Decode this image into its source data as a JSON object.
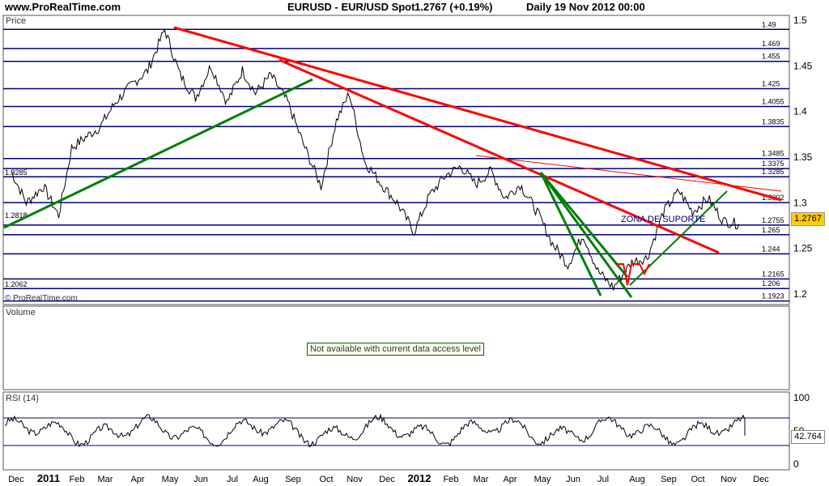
{
  "header": {
    "site": "www.ProRealTime.com",
    "instrument": "EURUSD - EUR/USD Spot",
    "last": "1.2767 (+0.19%)",
    "period": "Daily  19 Nov 2012 00:00"
  },
  "panels": {
    "price_title": "Price",
    "volume_title": "Volume",
    "volume_note": "Not available with current data access level",
    "rsi_title": "RSI (14)",
    "copyright": "© ProRealTime.com",
    "current_price": "1.2767",
    "rsi_value": "42.764",
    "annotation": "ZONA DE SUPORTE"
  },
  "colors": {
    "hline": "#00007f",
    "trend_red": "#ff0000",
    "trend_green": "#008000",
    "price": "#000000",
    "rsi": "#000000",
    "highlight": "#ffcc00"
  },
  "chart_data": [
    {
      "type": "bar",
      "title": "EURUSD - EUR/USD Spot",
      "ylabel": "Price",
      "ylim": [
        1.19,
        1.5
      ],
      "y_ticks": [
        1.2,
        1.25,
        1.3,
        1.35,
        1.4,
        1.45,
        1.5
      ],
      "x_ticks": [
        "Dec",
        "2011",
        "Feb",
        "Mar",
        "Apr",
        "May",
        "Jun",
        "Jul",
        "Aug",
        "Sep",
        "Oct",
        "Nov",
        "Dec",
        "2012",
        "Feb",
        "Mar",
        "Apr",
        "May",
        "Jun",
        "Jul",
        "Aug",
        "Sep",
        "Oct",
        "Nov",
        "Dec"
      ],
      "horizontal_levels": [
        {
          "value": 1.49,
          "label": "1.49"
        },
        {
          "value": 1.469,
          "label": "1.469"
        },
        {
          "value": 1.455,
          "label": "1.455"
        },
        {
          "value": 1.425,
          "label": "1.425"
        },
        {
          "value": 1.4055,
          "label": "1.4055"
        },
        {
          "value": 1.3835,
          "label": "1.3835"
        },
        {
          "value": 1.3485,
          "label": "1.3485"
        },
        {
          "value": 1.3375,
          "label": "1.3375"
        },
        {
          "value": 1.3285,
          "label": "1.3285"
        },
        {
          "value": 1.3002,
          "label": "1.3002"
        },
        {
          "value": 1.2755,
          "label": "1.2755"
        },
        {
          "value": 1.265,
          "label": "1.265"
        },
        {
          "value": 1.244,
          "label": "1.244"
        },
        {
          "value": 1.2165,
          "label": "1.2165"
        },
        {
          "value": 1.206,
          "label": "1.206"
        },
        {
          "value": 1.1923,
          "label": "1.1923"
        }
      ],
      "left_labels": [
        {
          "value": 1.3285,
          "label": "1.3285"
        },
        {
          "value": 1.2818,
          "label": "1.2818"
        },
        {
          "value": 1.2062,
          "label": "1.2062"
        }
      ],
      "price_path": [
        [
          "Dec 2010",
          1.335
        ],
        [
          "Dec 2010",
          1.3
        ],
        [
          "Jan 2011",
          1.318
        ],
        [
          "Jan 2011",
          1.286
        ],
        [
          "Feb 2011",
          1.36
        ],
        [
          "Feb 2011",
          1.373
        ],
        [
          "Mar 2011",
          1.383
        ],
        [
          "Mar 2011",
          1.41
        ],
        [
          "Apr 2011",
          1.43
        ],
        [
          "Apr 2011",
          1.445
        ],
        [
          "May 2011",
          1.49
        ],
        [
          "May 2011",
          1.44
        ],
        [
          "Jun 2011",
          1.415
        ],
        [
          "Jun 2011",
          1.45
        ],
        [
          "Jul 2011",
          1.41
        ],
        [
          "Jul 2011",
          1.445
        ],
        [
          "Aug 2011",
          1.42
        ],
        [
          "Aug 2011",
          1.44
        ],
        [
          "Sep 2011",
          1.41
        ],
        [
          "Sep 2011",
          1.365
        ],
        [
          "Oct 2011",
          1.318
        ],
        [
          "Oct 2011",
          1.39
        ],
        [
          "Nov 2011",
          1.42
        ],
        [
          "Nov 2011",
          1.345
        ],
        [
          "Dec 2011",
          1.32
        ],
        [
          "Dec 2011",
          1.3
        ],
        [
          "Jan 2012",
          1.268
        ],
        [
          "Jan 2012",
          1.308
        ],
        [
          "Feb 2012",
          1.33
        ],
        [
          "Feb 2012",
          1.34
        ],
        [
          "Mar 2012",
          1.32
        ],
        [
          "Mar 2012",
          1.335
        ],
        [
          "Apr 2012",
          1.305
        ],
        [
          "Apr 2012",
          1.32
        ],
        [
          "May 2012",
          1.29
        ],
        [
          "May 2012",
          1.255
        ],
        [
          "Jun 2012",
          1.232
        ],
        [
          "Jun 2012",
          1.265
        ],
        [
          "Jul 2012",
          1.225
        ],
        [
          "Jul 2012",
          1.207
        ],
        [
          "Aug 2012",
          1.235
        ],
        [
          "Aug 2012",
          1.24
        ],
        [
          "Sep 2012",
          1.29
        ],
        [
          "Sep 2012",
          1.313
        ],
        [
          "Oct 2012",
          1.29
        ],
        [
          "Oct 2012",
          1.305
        ],
        [
          "Nov 2012",
          1.28
        ],
        [
          "Nov 2012",
          1.2767
        ]
      ]
    },
    {
      "type": "line",
      "title": "RSI (14)",
      "ylim": [
        0,
        100
      ],
      "y_ticks": [
        0,
        50,
        100
      ],
      "levels": [
        30,
        70
      ],
      "last": 42.764
    }
  ]
}
